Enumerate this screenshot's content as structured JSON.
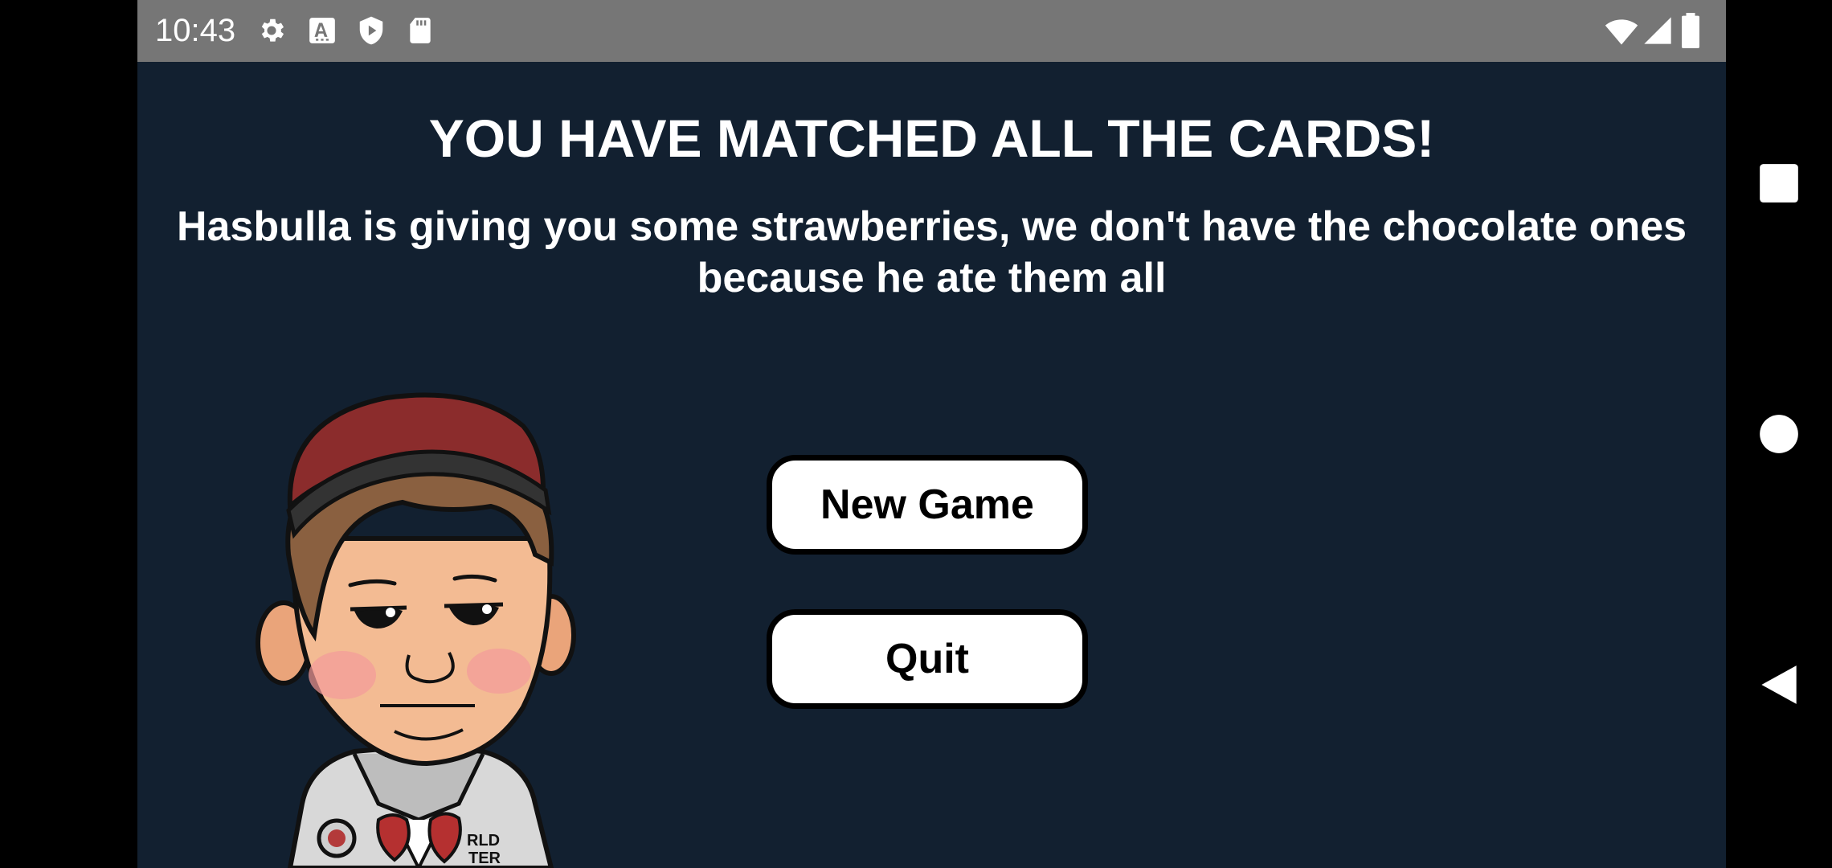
{
  "status_bar": {
    "time": "10:43",
    "icons": [
      "settings-icon",
      "font-a-icon",
      "play-protect-icon",
      "sd-card-icon",
      "wifi-icon",
      "cell-signal-icon",
      "battery-icon"
    ]
  },
  "game": {
    "headline": "YOU HAVE MATCHED ALL THE CARDS!",
    "message": "Hasbulla is giving you some strawberries, we don't have the chocolate ones because he ate them all",
    "buttons": {
      "new_game": "New Game",
      "quit": "Quit"
    },
    "character_shirt_text": [
      "RLD",
      "TER"
    ]
  },
  "colors": {
    "background": "#122030",
    "status_bar": "#767676",
    "button_bg": "#ffffff",
    "button_border": "#000000",
    "text": "#ffffff"
  },
  "nav_bar": {
    "buttons": [
      "recents-square-icon",
      "home-circle-icon",
      "back-triangle-icon"
    ]
  }
}
